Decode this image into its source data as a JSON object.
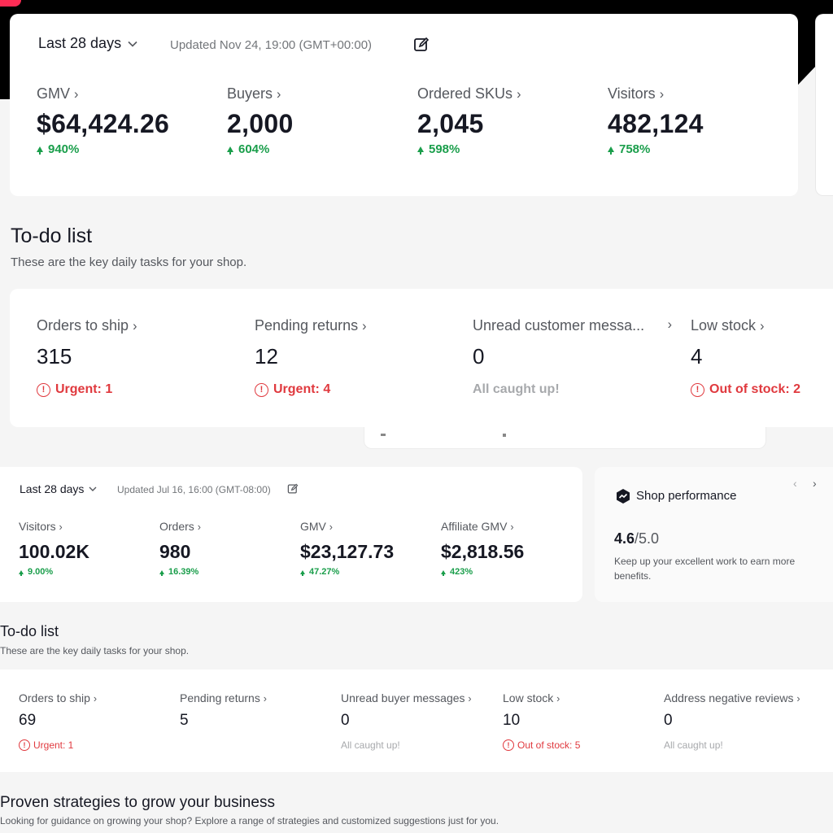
{
  "colors": {
    "accent_green": "#1a9e4b",
    "alert_red": "#e0393e",
    "brand": "#fe2c55"
  },
  "overview_top": {
    "date_range": "Last 28 days",
    "updated": "Updated Nov 24, 19:00 (GMT+00:00)",
    "metrics": [
      {
        "label": "GMV",
        "value": "$64,424.26",
        "change": "940%"
      },
      {
        "label": "Buyers",
        "value": "2,000",
        "change": "604%"
      },
      {
        "label": "Ordered SKUs",
        "value": "2,045",
        "change": "598%"
      },
      {
        "label": "Visitors",
        "value": "482,124",
        "change": "758%"
      }
    ]
  },
  "todo_top": {
    "title": "To-do list",
    "subtitle": "These are the key daily tasks for your shop.",
    "items": [
      {
        "label": "Orders to ship",
        "value": "315",
        "status": "Urgent: 1",
        "status_type": "alert"
      },
      {
        "label": "Pending returns",
        "value": "12",
        "status": "Urgent: 4",
        "status_type": "alert"
      },
      {
        "label": "Unread customer messa...",
        "value": "0",
        "status": "All caught up!",
        "status_type": "ok"
      },
      {
        "label": "Low stock",
        "value": "4",
        "status": "Out of stock: 2",
        "status_type": "alert"
      }
    ]
  },
  "overview_bottom": {
    "date_range": "Last 28 days",
    "updated": "Updated Jul 16, 16:00 (GMT-08:00)",
    "metrics": [
      {
        "label": "Visitors",
        "value": "100.02K",
        "change": "9.00%"
      },
      {
        "label": "Orders",
        "value": "980",
        "change": "16.39%"
      },
      {
        "label": "GMV",
        "value": "$23,127.73",
        "change": "47.27%"
      },
      {
        "label": "Affiliate GMV",
        "value": "$2,818.56",
        "change": "423%"
      }
    ]
  },
  "shop_performance": {
    "title": "Shop performance",
    "score": "4.6",
    "score_max": "/5.0",
    "description": "Keep up your excellent work to earn more benefits.",
    "prev_icon": "chevron-left-icon",
    "next_icon": "chevron-right-icon"
  },
  "todo_bottom": {
    "title": "To-do list",
    "subtitle": "These are the key daily tasks for your shop.",
    "items": [
      {
        "label": "Orders to ship",
        "value": "69",
        "status": "Urgent: 1",
        "status_type": "alert"
      },
      {
        "label": "Pending returns",
        "value": "5",
        "status": "",
        "status_type": "none"
      },
      {
        "label": "Unread buyer messages",
        "value": "0",
        "status": "All caught up!",
        "status_type": "ok"
      },
      {
        "label": "Low stock",
        "value": "10",
        "status": "Out of stock: 5",
        "status_type": "alert"
      },
      {
        "label": "Address negative reviews",
        "value": "0",
        "status": "All caught up!",
        "status_type": "ok"
      }
    ]
  },
  "strategies": {
    "title": "Proven strategies to grow your business",
    "subtitle": "Looking for guidance on growing your shop? Explore a range of strategies and customized suggestions just for you."
  }
}
